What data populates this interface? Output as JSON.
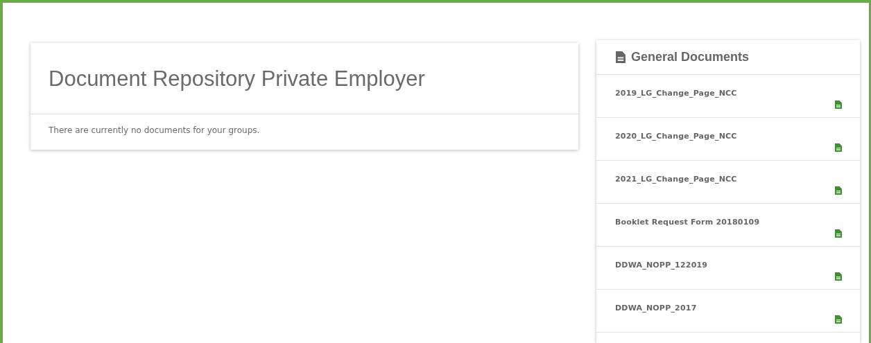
{
  "repository": {
    "title": "Document Repository Private Employer",
    "message": "There are currently no documents for your groups."
  },
  "general_documents": {
    "title": "General Documents",
    "items": [
      {
        "name": "2019_LG_Change_Page_NCC"
      },
      {
        "name": "2020_LG_Change_Page_NCC"
      },
      {
        "name": "2021_LG_Change_Page_NCC"
      },
      {
        "name": "Booklet Request Form 20180109"
      },
      {
        "name": "DDWA_NOPP_122019"
      },
      {
        "name": "DDWA_NOPP_2017"
      }
    ]
  }
}
